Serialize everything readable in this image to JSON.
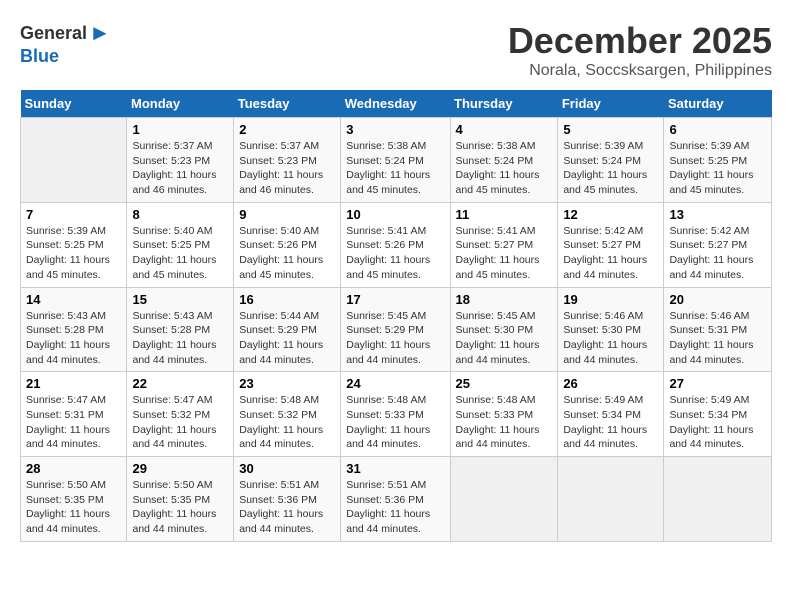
{
  "logo": {
    "general": "General",
    "blue": "Blue"
  },
  "title": "December 2025",
  "subtitle": "Norala, Soccsksargen, Philippines",
  "days_header": [
    "Sunday",
    "Monday",
    "Tuesday",
    "Wednesday",
    "Thursday",
    "Friday",
    "Saturday"
  ],
  "weeks": [
    [
      {
        "num": "",
        "info": ""
      },
      {
        "num": "1",
        "info": "Sunrise: 5:37 AM\nSunset: 5:23 PM\nDaylight: 11 hours\nand 46 minutes."
      },
      {
        "num": "2",
        "info": "Sunrise: 5:37 AM\nSunset: 5:23 PM\nDaylight: 11 hours\nand 46 minutes."
      },
      {
        "num": "3",
        "info": "Sunrise: 5:38 AM\nSunset: 5:24 PM\nDaylight: 11 hours\nand 45 minutes."
      },
      {
        "num": "4",
        "info": "Sunrise: 5:38 AM\nSunset: 5:24 PM\nDaylight: 11 hours\nand 45 minutes."
      },
      {
        "num": "5",
        "info": "Sunrise: 5:39 AM\nSunset: 5:24 PM\nDaylight: 11 hours\nand 45 minutes."
      },
      {
        "num": "6",
        "info": "Sunrise: 5:39 AM\nSunset: 5:25 PM\nDaylight: 11 hours\nand 45 minutes."
      }
    ],
    [
      {
        "num": "7",
        "info": "Sunrise: 5:39 AM\nSunset: 5:25 PM\nDaylight: 11 hours\nand 45 minutes."
      },
      {
        "num": "8",
        "info": "Sunrise: 5:40 AM\nSunset: 5:25 PM\nDaylight: 11 hours\nand 45 minutes."
      },
      {
        "num": "9",
        "info": "Sunrise: 5:40 AM\nSunset: 5:26 PM\nDaylight: 11 hours\nand 45 minutes."
      },
      {
        "num": "10",
        "info": "Sunrise: 5:41 AM\nSunset: 5:26 PM\nDaylight: 11 hours\nand 45 minutes."
      },
      {
        "num": "11",
        "info": "Sunrise: 5:41 AM\nSunset: 5:27 PM\nDaylight: 11 hours\nand 45 minutes."
      },
      {
        "num": "12",
        "info": "Sunrise: 5:42 AM\nSunset: 5:27 PM\nDaylight: 11 hours\nand 44 minutes."
      },
      {
        "num": "13",
        "info": "Sunrise: 5:42 AM\nSunset: 5:27 PM\nDaylight: 11 hours\nand 44 minutes."
      }
    ],
    [
      {
        "num": "14",
        "info": "Sunrise: 5:43 AM\nSunset: 5:28 PM\nDaylight: 11 hours\nand 44 minutes."
      },
      {
        "num": "15",
        "info": "Sunrise: 5:43 AM\nSunset: 5:28 PM\nDaylight: 11 hours\nand 44 minutes."
      },
      {
        "num": "16",
        "info": "Sunrise: 5:44 AM\nSunset: 5:29 PM\nDaylight: 11 hours\nand 44 minutes."
      },
      {
        "num": "17",
        "info": "Sunrise: 5:45 AM\nSunset: 5:29 PM\nDaylight: 11 hours\nand 44 minutes."
      },
      {
        "num": "18",
        "info": "Sunrise: 5:45 AM\nSunset: 5:30 PM\nDaylight: 11 hours\nand 44 minutes."
      },
      {
        "num": "19",
        "info": "Sunrise: 5:46 AM\nSunset: 5:30 PM\nDaylight: 11 hours\nand 44 minutes."
      },
      {
        "num": "20",
        "info": "Sunrise: 5:46 AM\nSunset: 5:31 PM\nDaylight: 11 hours\nand 44 minutes."
      }
    ],
    [
      {
        "num": "21",
        "info": "Sunrise: 5:47 AM\nSunset: 5:31 PM\nDaylight: 11 hours\nand 44 minutes."
      },
      {
        "num": "22",
        "info": "Sunrise: 5:47 AM\nSunset: 5:32 PM\nDaylight: 11 hours\nand 44 minutes."
      },
      {
        "num": "23",
        "info": "Sunrise: 5:48 AM\nSunset: 5:32 PM\nDaylight: 11 hours\nand 44 minutes."
      },
      {
        "num": "24",
        "info": "Sunrise: 5:48 AM\nSunset: 5:33 PM\nDaylight: 11 hours\nand 44 minutes."
      },
      {
        "num": "25",
        "info": "Sunrise: 5:48 AM\nSunset: 5:33 PM\nDaylight: 11 hours\nand 44 minutes."
      },
      {
        "num": "26",
        "info": "Sunrise: 5:49 AM\nSunset: 5:34 PM\nDaylight: 11 hours\nand 44 minutes."
      },
      {
        "num": "27",
        "info": "Sunrise: 5:49 AM\nSunset: 5:34 PM\nDaylight: 11 hours\nand 44 minutes."
      }
    ],
    [
      {
        "num": "28",
        "info": "Sunrise: 5:50 AM\nSunset: 5:35 PM\nDaylight: 11 hours\nand 44 minutes."
      },
      {
        "num": "29",
        "info": "Sunrise: 5:50 AM\nSunset: 5:35 PM\nDaylight: 11 hours\nand 44 minutes."
      },
      {
        "num": "30",
        "info": "Sunrise: 5:51 AM\nSunset: 5:36 PM\nDaylight: 11 hours\nand 44 minutes."
      },
      {
        "num": "31",
        "info": "Sunrise: 5:51 AM\nSunset: 5:36 PM\nDaylight: 11 hours\nand 44 minutes."
      },
      {
        "num": "",
        "info": ""
      },
      {
        "num": "",
        "info": ""
      },
      {
        "num": "",
        "info": ""
      }
    ]
  ]
}
